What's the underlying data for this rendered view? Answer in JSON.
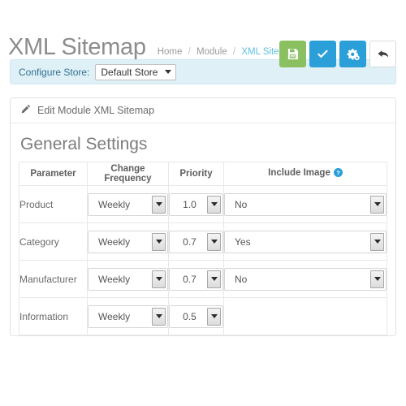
{
  "header": {
    "title": "XML Sitemap",
    "breadcrumb": [
      {
        "label": "Home",
        "active": false
      },
      {
        "label": "Module",
        "active": false
      },
      {
        "label": "XML Sitemap",
        "active": true
      }
    ],
    "separator": "/",
    "buttons": [
      {
        "name": "save-button",
        "icon": "save-icon",
        "style": "green"
      },
      {
        "name": "apply-button",
        "icon": "check-icon",
        "style": "blue"
      },
      {
        "name": "settings-button",
        "icon": "gears-icon",
        "style": "blue"
      },
      {
        "name": "back-button",
        "icon": "back-arrow-icon",
        "style": "white"
      }
    ],
    "colors": {
      "green": "#8ac060",
      "blue": "#2a9fd8",
      "breadcrumb_active": "#5bc0de",
      "title": "#8d8d8d"
    }
  },
  "store_bar": {
    "label": "Configure Store:",
    "selected_store": "Default Store",
    "background": "#dff0f7",
    "text_color": "#31708f"
  },
  "panel": {
    "heading": "Edit Module XML Sitemap",
    "section_title": "General Settings"
  },
  "table": {
    "headers": [
      "Parameter",
      "Change Frequency",
      "Priority",
      "Include Image"
    ],
    "help_tooltip_column": "Include Image",
    "rows": [
      {
        "parameter": "Product",
        "change_frequency": "Weekly",
        "priority": "1.0",
        "include_image": "No",
        "has_include_image": true
      },
      {
        "parameter": "Category",
        "change_frequency": "Weekly",
        "priority": "0.7",
        "include_image": "Yes",
        "has_include_image": true
      },
      {
        "parameter": "Manufacturer",
        "change_frequency": "Weekly",
        "priority": "0.7",
        "include_image": "No",
        "has_include_image": true
      },
      {
        "parameter": "Information",
        "change_frequency": "Weekly",
        "priority": "0.5",
        "include_image": "",
        "has_include_image": false
      }
    ]
  }
}
